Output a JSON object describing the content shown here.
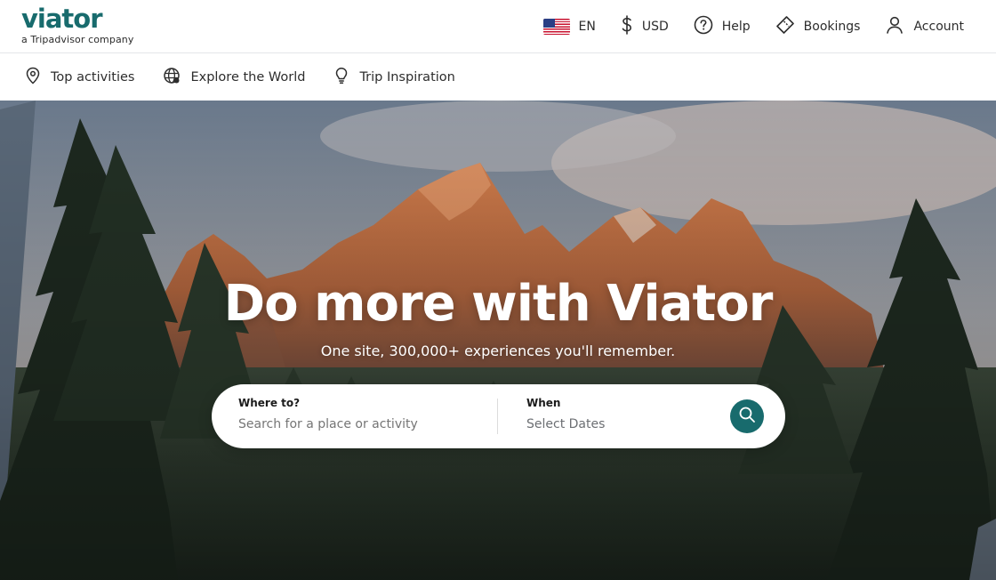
{
  "colors": {
    "brand": "#186b6d",
    "search_button": "#186b6d"
  },
  "header": {
    "logo_text": "viator",
    "logo_tagline": "a Tripadvisor company",
    "language": {
      "label": "EN",
      "icon": "us-flag-icon"
    },
    "currency": {
      "label": "USD",
      "icon": "dollar-icon"
    },
    "help": {
      "label": "Help",
      "icon": "help-circle-icon"
    },
    "bookings": {
      "label": "Bookings",
      "icon": "ticket-icon"
    },
    "account": {
      "label": "Account",
      "icon": "user-icon"
    }
  },
  "subnav": {
    "items": [
      {
        "label": "Top activities",
        "icon": "map-pin-icon"
      },
      {
        "label": "Explore the World",
        "icon": "globe-icon"
      },
      {
        "label": "Trip Inspiration",
        "icon": "lightbulb-icon"
      }
    ]
  },
  "hero": {
    "title": "Do more with Viator",
    "subtitle": "One site, 300,000+ experiences you'll remember.",
    "search": {
      "where_label": "Where to?",
      "where_placeholder": "Search for a place or activity",
      "when_label": "When",
      "when_value": "Select Dates",
      "button_icon": "search-icon"
    }
  }
}
